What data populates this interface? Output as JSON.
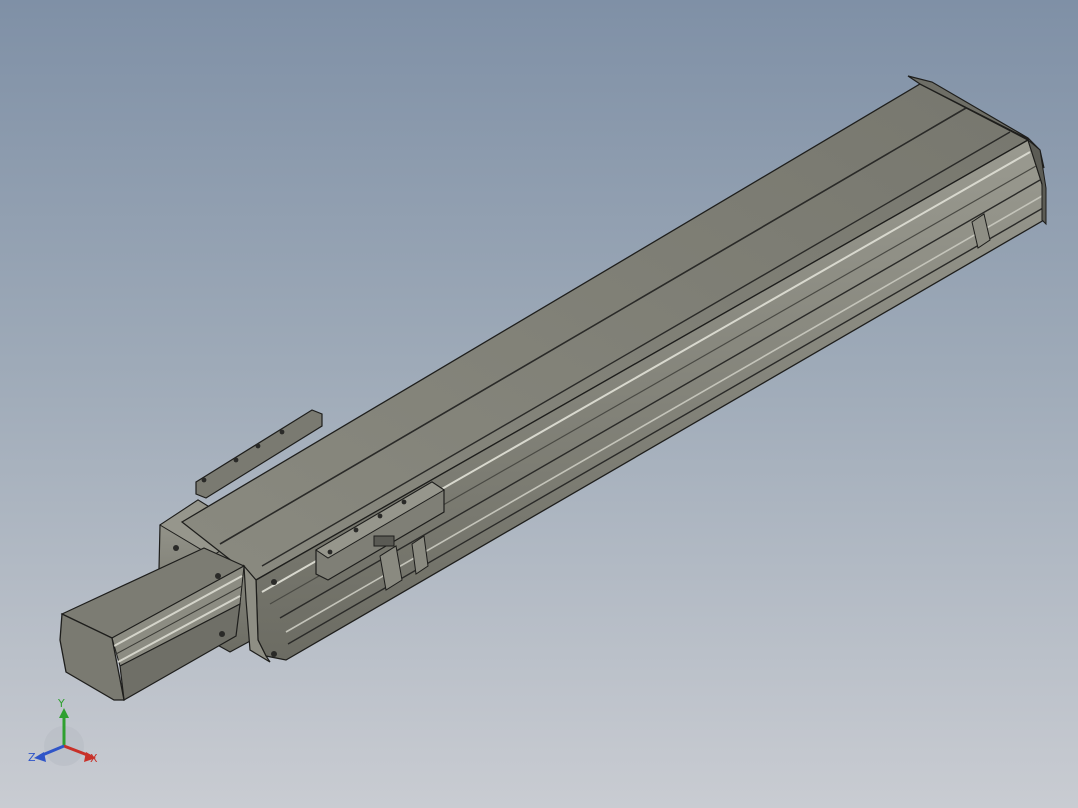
{
  "viewport": {
    "background_top": "#7f90a6",
    "background_bottom": "#c9ccd2"
  },
  "model": {
    "body_color": "#84847a",
    "edge_color": "#1e1e1c",
    "parts": [
      "linear-actuator-body",
      "stepper-motor",
      "carriage-slider",
      "end-cap",
      "mounting-plate"
    ]
  },
  "triad": {
    "x_label": "X",
    "y_label": "Y",
    "z_label": "Z",
    "x_color": "#c83028",
    "y_color": "#2fa02f",
    "z_color": "#2f55c8"
  }
}
